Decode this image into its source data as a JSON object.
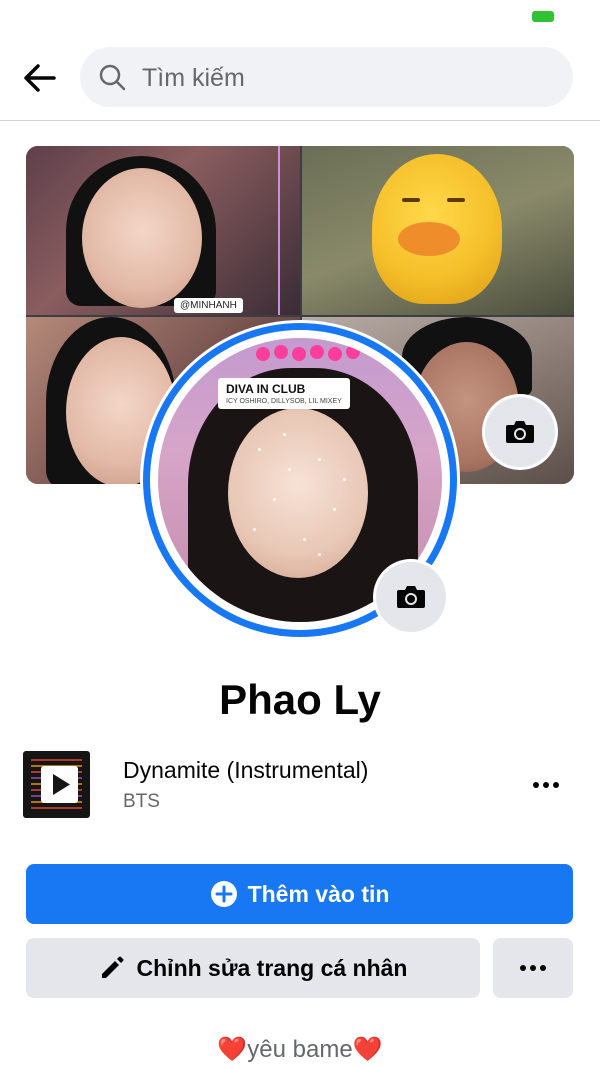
{
  "search": {
    "placeholder": "Tìm kiếm",
    "value": ""
  },
  "cover": {
    "tag_text": "@MINHANH",
    "filter_title": "DIVA IN CLUB",
    "filter_sub": "ICY OSHIRO, DILLYSOB, LIL MIXEY"
  },
  "profile": {
    "name": "Phao Ly",
    "bio": "❤️yêu bame❤️"
  },
  "music": {
    "title": "Dynamite (Instrumental)",
    "artist": "BTS"
  },
  "actions": {
    "add_story_label": "Thêm vào tin",
    "edit_profile_label": "Chỉnh sửa trang cá nhân"
  },
  "colors": {
    "accent": "#1877f2",
    "button_gray": "#e4e6eb",
    "battery": "#31c233"
  },
  "icons": [
    "back-arrow-icon",
    "search-icon",
    "camera-icon",
    "play-icon",
    "more-dots-icon",
    "plus-circle-icon",
    "pencil-icon"
  ]
}
